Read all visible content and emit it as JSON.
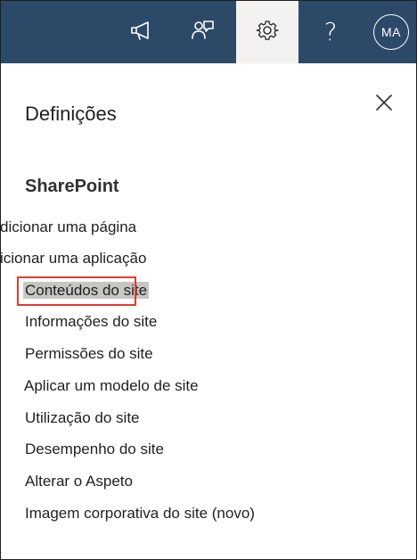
{
  "header": {
    "avatar_initials": "MA",
    "help_glyph": "?",
    "icons": [
      "megaphone-icon",
      "feedback-icon",
      "gear-icon",
      "help-icon",
      "avatar"
    ],
    "bar_color": "#2c4a68",
    "active_tab_color": "#f3f2f1"
  },
  "panel": {
    "title": "Definições",
    "close_icon": "close-icon",
    "section_title": "SharePoint",
    "items": [
      {
        "label": "dicionar uma página"
      },
      {
        "label": "icionar uma aplicação"
      },
      {
        "label": "Conteúdos do site",
        "highlighted": true
      },
      {
        "label": "Informações do site"
      },
      {
        "label": "Permissões do site"
      },
      {
        "label": "Aplicar um modelo de site"
      },
      {
        "label": "Utilização do site"
      },
      {
        "label": "Desempenho do site"
      },
      {
        "label": "Alterar o Aspeto"
      },
      {
        "label": "Imagem corporativa do site (novo)"
      }
    ],
    "highlight_color": "#e03c31"
  }
}
